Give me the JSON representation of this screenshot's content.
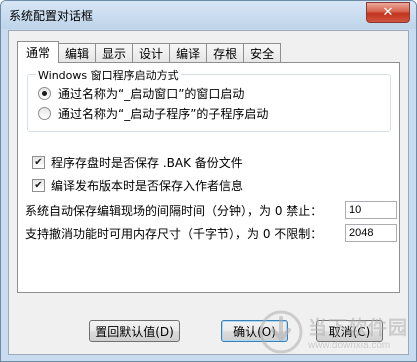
{
  "window": {
    "title": "系统配置对话框",
    "close_symbol": "✕"
  },
  "tabs": [
    {
      "label": "通常",
      "active": true
    },
    {
      "label": "编辑",
      "active": false
    },
    {
      "label": "显示",
      "active": false
    },
    {
      "label": "设计",
      "active": false
    },
    {
      "label": "编译",
      "active": false
    },
    {
      "label": "存根",
      "active": false
    },
    {
      "label": "安全",
      "active": false
    }
  ],
  "startup_group": {
    "legend": "Windows 窗口程序启动方式",
    "options": [
      {
        "label": "通过名称为“_启动窗口”的窗口启动",
        "checked": true
      },
      {
        "label": "通过名称为“_启动子程序”的子程序启动",
        "checked": false
      }
    ]
  },
  "checkboxes": [
    {
      "label": "程序存盘时是否保存 .BAK 备份文件",
      "checked": true
    },
    {
      "label": "编译发布版本时是否保存入作者信息",
      "checked": true
    }
  ],
  "fields": [
    {
      "label": "系统自动保存编辑现场的间隔时间（分钟），为 0 禁止：",
      "value": "10"
    },
    {
      "label": "支持撤消功能时可用内存尺寸（千字节），为 0 不限制：",
      "value": "2048"
    }
  ],
  "buttons": {
    "reset": "置回默认值(D)",
    "ok": "确认(O)",
    "cancel": "取消(C)"
  },
  "watermark": {
    "title": "当下软件园",
    "url": "www.downxia.com"
  },
  "colors": {
    "titlebar": "#c9dcef",
    "close_button": "#c7402a",
    "client_background": "#f0f0f0",
    "panel_background": "#ffffff"
  }
}
